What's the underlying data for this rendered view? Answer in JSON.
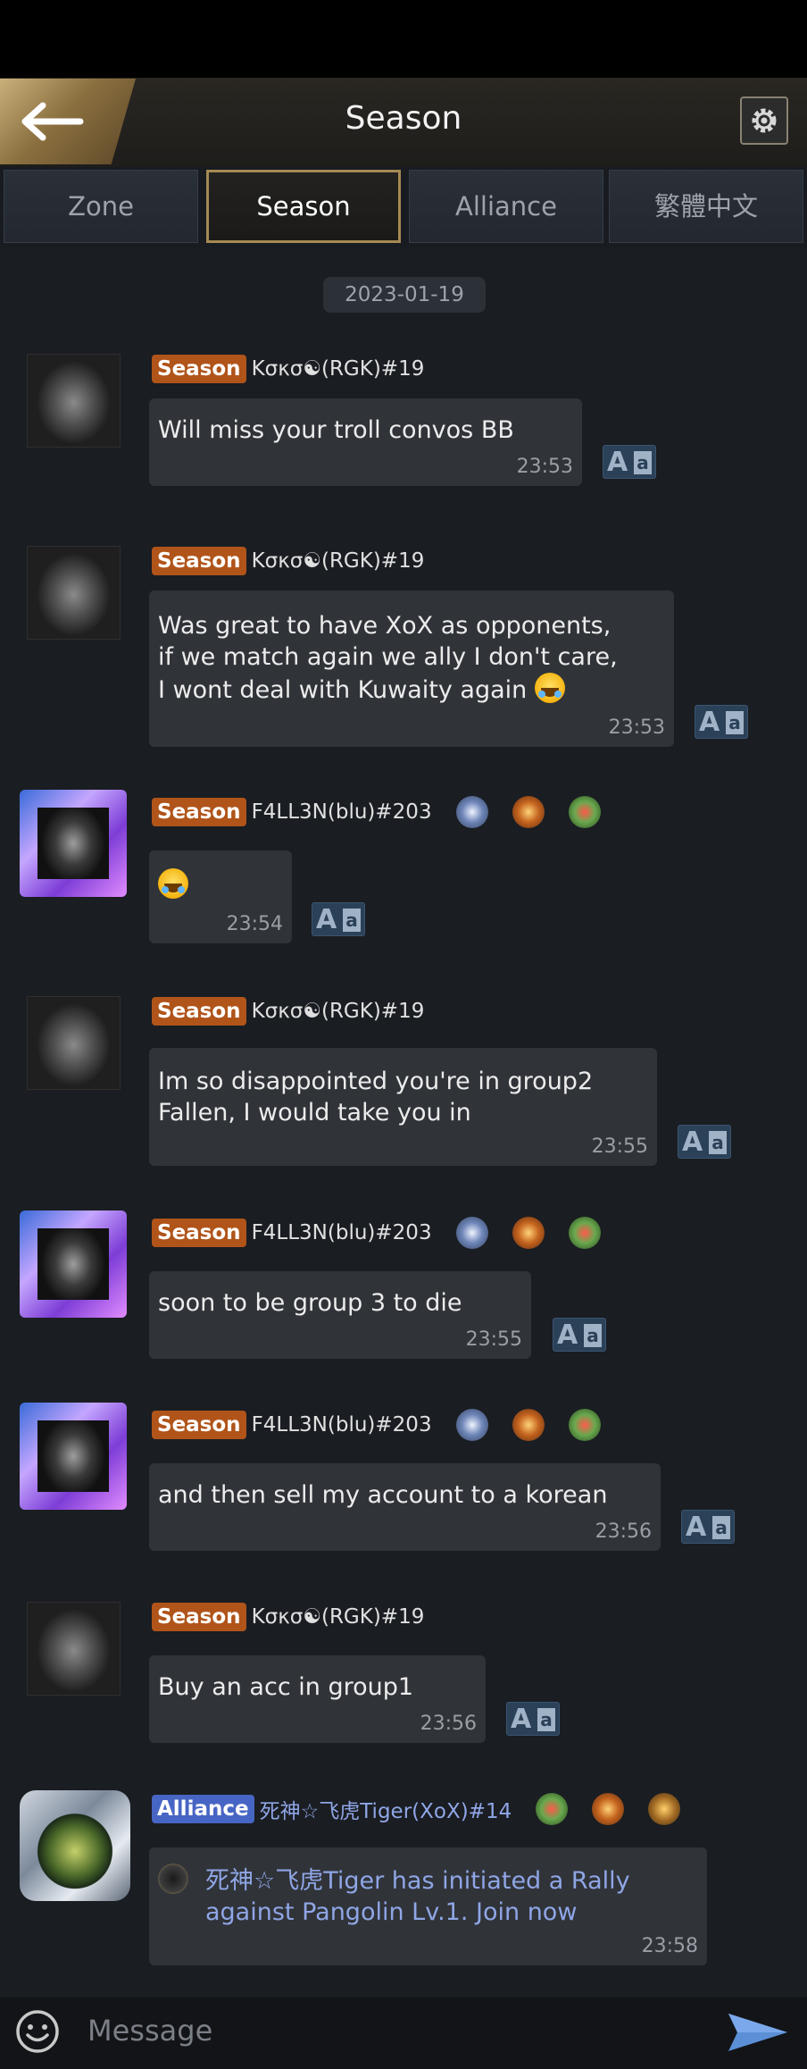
{
  "header": {
    "title": "Season",
    "back_icon": "arrow-left-icon",
    "settings_icon": "gear-icon"
  },
  "tabs": [
    {
      "label": "Zone",
      "active": false
    },
    {
      "label": "Season",
      "active": true
    },
    {
      "label": "Alliance",
      "active": false
    },
    {
      "label": "繁體中文",
      "active": false
    }
  ],
  "date_label": "2023-01-19",
  "messages": [
    {
      "tag": "Season",
      "sender": "Kσκσ☯(RGK)#19",
      "lines": [
        "Will miss your troll convos BB"
      ],
      "time": "23:53",
      "badges": []
    },
    {
      "tag": "Season",
      "sender": "Kσκσ☯(RGK)#19",
      "lines": [
        "Was great to have XoX as opponents,",
        "if we match again we ally I don't care,",
        "I wont deal with Kuwaity again 😂"
      ],
      "time": "23:53",
      "badges": []
    },
    {
      "tag": "Season",
      "sender": "F4LL3N(blu)#203",
      "lines": [
        "😂"
      ],
      "time": "23:54",
      "badges": [
        "skull-badge-icon",
        "fire-badge-icon",
        "heart-wreath-badge-icon"
      ]
    },
    {
      "tag": "Season",
      "sender": "Kσκσ☯(RGK)#19",
      "lines": [
        "Im so disappointed you're in group2",
        "Fallen, I would take you in"
      ],
      "time": "23:55",
      "badges": []
    },
    {
      "tag": "Season",
      "sender": "F4LL3N(blu)#203",
      "lines": [
        "soon to be group 3 to die"
      ],
      "time": "23:55",
      "badges": [
        "skull-badge-icon",
        "fire-badge-icon",
        "heart-wreath-badge-icon"
      ]
    },
    {
      "tag": "Season",
      "sender": "F4LL3N(blu)#203",
      "lines": [
        "and then sell my account to a korean"
      ],
      "time": "23:56",
      "badges": [
        "skull-badge-icon",
        "fire-badge-icon",
        "heart-wreath-badge-icon"
      ]
    },
    {
      "tag": "Season",
      "sender": "Kσκσ☯(RGK)#19",
      "lines": [
        "Buy an acc in group1"
      ],
      "time": "23:56",
      "badges": []
    },
    {
      "tag": "Alliance",
      "sender": "死神☆飞虎Tiger(XoX)#14",
      "lines": [
        "死神☆飞虎Tiger has initiated a Rally",
        "against Pangolin Lv.1. Join now"
      ],
      "time": "23:58",
      "badges": [
        "red-gem-badge-icon",
        "fire-badge-icon",
        "gold-shield-badge-icon"
      ]
    }
  ],
  "translate_button": {
    "big": "A",
    "small": "a"
  },
  "composer": {
    "placeholder": "Message",
    "emoji_icon": "smiley-icon",
    "send_icon": "send-arrow-icon"
  },
  "colors": {
    "season_tag": "#b0541a",
    "alliance_tag": "#4765c4",
    "active_tab_border": "#a58a52",
    "background": "#1a1d22"
  }
}
